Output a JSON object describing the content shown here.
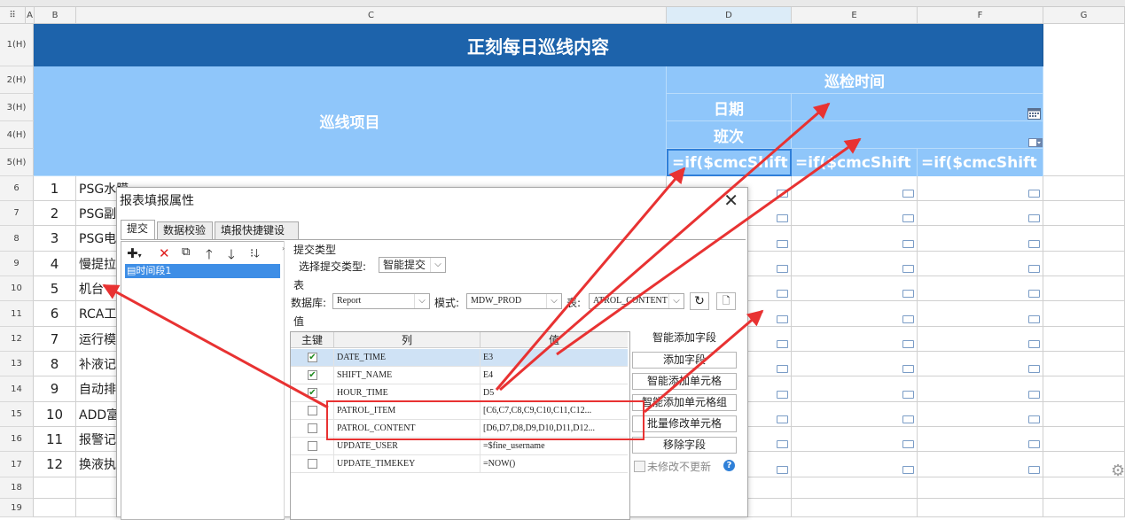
{
  "sheet": {
    "columns": [
      "A",
      "B",
      "C",
      "D",
      "E",
      "F",
      "G"
    ],
    "rows": [
      "1(H)",
      "2(H)",
      "3(H)",
      "4(H)",
      "5(H)",
      "6",
      "7",
      "8",
      "9",
      "10",
      "11",
      "12",
      "13",
      "14",
      "15",
      "16",
      "17",
      "18",
      "19"
    ],
    "title": "正刻每日巡线内容",
    "header_item": "巡线项目",
    "header_time": "巡检时间",
    "header_date": "日期",
    "header_shift": "班次",
    "formula_d5": "=if($cmcShift",
    "formula_e5": "=if($cmcShift",
    "formula_f5": "=if($cmcShift",
    "items": [
      {
        "no": "1",
        "text": "PSG水膜"
      },
      {
        "no": "2",
        "text": "PSG副"
      },
      {
        "no": "3",
        "text": "PSG电"
      },
      {
        "no": "4",
        "text": "慢提拉"
      },
      {
        "no": "5",
        "text": "机台"
      },
      {
        "no": "6",
        "text": "RCA工"
      },
      {
        "no": "7",
        "text": "运行模"
      },
      {
        "no": "8",
        "text": "补液记"
      },
      {
        "no": "9",
        "text": "自动排"
      },
      {
        "no": "10",
        "text": "ADD富"
      },
      {
        "no": "11",
        "text": "报警记"
      },
      {
        "no": "12",
        "text": "换液执"
      }
    ],
    "colors": {
      "title_bg": "#1d63ab",
      "header_bg": "#8fc6fa",
      "arrow": "#e83232"
    }
  },
  "dialog": {
    "title": "报表填报属性",
    "tabs": [
      "提交",
      "数据校验",
      "填报快捷键设置"
    ],
    "tree_item": "时间段1",
    "submit_type_section": "提交类型",
    "submit_type_label": "选择提交类型:",
    "submit_type_value": "智能提交",
    "table_section": "表",
    "db_label": "数据库:",
    "db_value": "Report",
    "mode_label": "模式:",
    "mode_value": "MDW_PROD",
    "table_label": "表:",
    "table_value": "ATROL_CONTENT",
    "value_section": "值",
    "col_key": "主键",
    "col_column": "列",
    "col_value": "值",
    "rows": [
      {
        "key": true,
        "column": "DATE_TIME",
        "value": "E3"
      },
      {
        "key": true,
        "column": "SHIFT_NAME",
        "value": "E4"
      },
      {
        "key": true,
        "column": "HOUR_TIME",
        "value": "D5"
      },
      {
        "key": false,
        "column": "PATROL_ITEM",
        "value": "[C6,C7,C8,C9,C10,C11,C12..."
      },
      {
        "key": false,
        "column": "PATROL_CONTENT",
        "value": "[D6,D7,D8,D9,D10,D11,D12..."
      },
      {
        "key": false,
        "column": "UPDATE_USER",
        "value": "=$fine_username"
      },
      {
        "key": false,
        "column": "UPDATE_TIMEKEY",
        "value": "=NOW()"
      }
    ],
    "buttons": [
      "智能添加字段",
      "添加字段",
      "智能添加单元格",
      "智能添加单元格组",
      "批量修改单元格",
      "移除字段"
    ],
    "no_update_label": "未修改不更新"
  }
}
